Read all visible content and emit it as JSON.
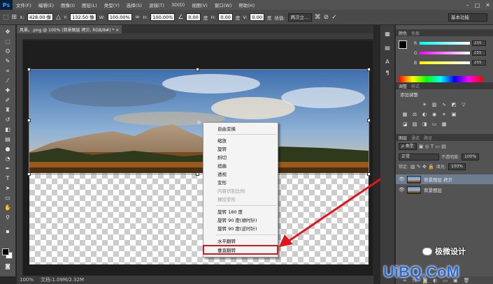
{
  "app": {
    "logo": "Ps"
  },
  "menubar": {
    "items": [
      "文件(F)",
      "编辑(E)",
      "图像(I)",
      "图层(L)",
      "类型(Y)",
      "选择(S)",
      "滤镜(T)",
      "3D(D)",
      "视图(V)",
      "窗口(W)",
      "帮助(H)"
    ],
    "window_controls": [
      "–",
      "□",
      "✕"
    ]
  },
  "options_bar": {
    "x_label": "X:",
    "x_value": "428.00 像",
    "y_label": "Y:",
    "y_value": "132.50 像",
    "w_label": "W:",
    "w_value": "100.00%",
    "h_label": "H:",
    "h_value": "100.00%",
    "angle_value": "0.00",
    "angle_unit": "度",
    "hskew_label": "H:",
    "hskew_value": "0.00",
    "hskew_unit": "度",
    "vskew_label": "V:",
    "vskew_value": "0.00",
    "vskew_unit": "度",
    "interp_label": "插值:",
    "interp_value": "两次立…",
    "workspace": "基本功能"
  },
  "document": {
    "tab_title": "风景。.png @ 100% (背景图层 拷贝, RGB/8#) * ×",
    "status_zoom": "100%",
    "status_doc": "文档:1.09M/2.32M"
  },
  "context_menu": {
    "items": [
      {
        "label": "自由变换",
        "disabled": false
      },
      {
        "label": "缩放",
        "disabled": false
      },
      {
        "label": "旋转",
        "disabled": false
      },
      {
        "label": "斜切",
        "disabled": false
      },
      {
        "label": "扭曲",
        "disabled": false
      },
      {
        "label": "透视",
        "disabled": false
      },
      {
        "label": "变形",
        "disabled": false
      },
      {
        "label": "内容识别比例",
        "disabled": true
      },
      {
        "label": "操控变形",
        "disabled": true
      },
      {
        "label": "旋转 180 度",
        "disabled": false
      },
      {
        "label": "旋转 90 度(顺时针)",
        "disabled": false
      },
      {
        "label": "旋转 90 度(逆时针)",
        "disabled": false
      },
      {
        "label": "水平翻转",
        "disabled": false
      },
      {
        "label": "垂直翻转",
        "disabled": false
      }
    ],
    "highlighted": "垂直翻转",
    "highlight_color": "#e0161c"
  },
  "color_panel": {
    "tabs": [
      "颜色",
      "色板"
    ],
    "r_label": "R",
    "r_value": "255",
    "g_label": "G",
    "g_value": "255",
    "b_label": "B",
    "b_value": "255"
  },
  "adjustments_panel": {
    "tabs": [
      "调整",
      "样式"
    ],
    "title": "添加调整"
  },
  "layers_panel": {
    "tabs": [
      "图层",
      "通道",
      "路径"
    ],
    "filter_kind": "ρ 类型",
    "blend_mode": "正常",
    "opacity_label": "不透明度:",
    "opacity_value": "100%",
    "lock_label": "锁定:",
    "fill_label": "填充:",
    "fill_value": "100%",
    "layers": [
      {
        "name": "背景图层 拷贝",
        "selected": true
      },
      {
        "name": "背景图层",
        "selected": false
      }
    ]
  },
  "watermark": {
    "badge_text": "极微设计",
    "site": "UiBQ.CoM"
  },
  "colors": {
    "accent_red": "#e0161c",
    "selection_blue": "#6d7c90"
  }
}
